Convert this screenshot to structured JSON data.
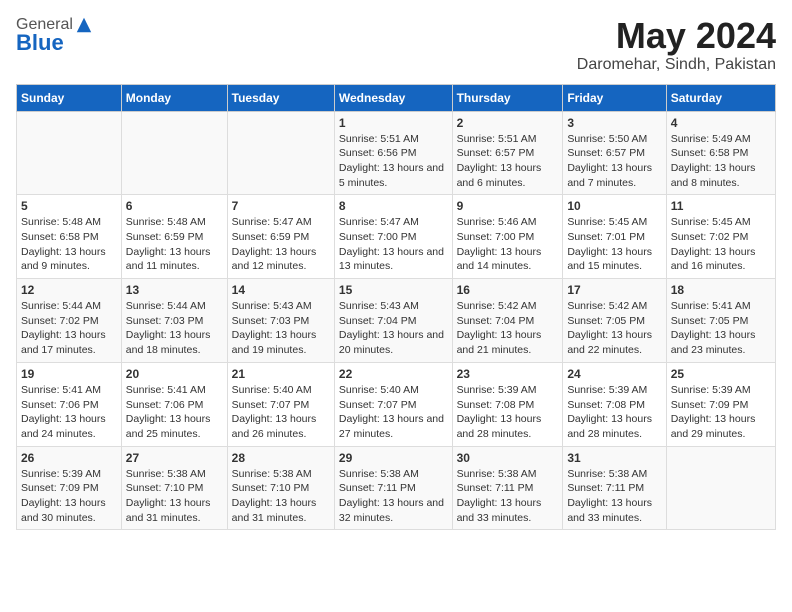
{
  "logo": {
    "general": "General",
    "blue": "Blue"
  },
  "title": "May 2024",
  "subtitle": "Daromehar, Sindh, Pakistan",
  "days_of_week": [
    "Sunday",
    "Monday",
    "Tuesday",
    "Wednesday",
    "Thursday",
    "Friday",
    "Saturday"
  ],
  "weeks": [
    [
      {
        "day": "",
        "content": ""
      },
      {
        "day": "",
        "content": ""
      },
      {
        "day": "",
        "content": ""
      },
      {
        "day": "1",
        "content": "Sunrise: 5:51 AM\nSunset: 6:56 PM\nDaylight: 13 hours and 5 minutes."
      },
      {
        "day": "2",
        "content": "Sunrise: 5:51 AM\nSunset: 6:57 PM\nDaylight: 13 hours and 6 minutes."
      },
      {
        "day": "3",
        "content": "Sunrise: 5:50 AM\nSunset: 6:57 PM\nDaylight: 13 hours and 7 minutes."
      },
      {
        "day": "4",
        "content": "Sunrise: 5:49 AM\nSunset: 6:58 PM\nDaylight: 13 hours and 8 minutes."
      }
    ],
    [
      {
        "day": "5",
        "content": "Sunrise: 5:48 AM\nSunset: 6:58 PM\nDaylight: 13 hours and 9 minutes."
      },
      {
        "day": "6",
        "content": "Sunrise: 5:48 AM\nSunset: 6:59 PM\nDaylight: 13 hours and 11 minutes."
      },
      {
        "day": "7",
        "content": "Sunrise: 5:47 AM\nSunset: 6:59 PM\nDaylight: 13 hours and 12 minutes."
      },
      {
        "day": "8",
        "content": "Sunrise: 5:47 AM\nSunset: 7:00 PM\nDaylight: 13 hours and 13 minutes."
      },
      {
        "day": "9",
        "content": "Sunrise: 5:46 AM\nSunset: 7:00 PM\nDaylight: 13 hours and 14 minutes."
      },
      {
        "day": "10",
        "content": "Sunrise: 5:45 AM\nSunset: 7:01 PM\nDaylight: 13 hours and 15 minutes."
      },
      {
        "day": "11",
        "content": "Sunrise: 5:45 AM\nSunset: 7:02 PM\nDaylight: 13 hours and 16 minutes."
      }
    ],
    [
      {
        "day": "12",
        "content": "Sunrise: 5:44 AM\nSunset: 7:02 PM\nDaylight: 13 hours and 17 minutes."
      },
      {
        "day": "13",
        "content": "Sunrise: 5:44 AM\nSunset: 7:03 PM\nDaylight: 13 hours and 18 minutes."
      },
      {
        "day": "14",
        "content": "Sunrise: 5:43 AM\nSunset: 7:03 PM\nDaylight: 13 hours and 19 minutes."
      },
      {
        "day": "15",
        "content": "Sunrise: 5:43 AM\nSunset: 7:04 PM\nDaylight: 13 hours and 20 minutes."
      },
      {
        "day": "16",
        "content": "Sunrise: 5:42 AM\nSunset: 7:04 PM\nDaylight: 13 hours and 21 minutes."
      },
      {
        "day": "17",
        "content": "Sunrise: 5:42 AM\nSunset: 7:05 PM\nDaylight: 13 hours and 22 minutes."
      },
      {
        "day": "18",
        "content": "Sunrise: 5:41 AM\nSunset: 7:05 PM\nDaylight: 13 hours and 23 minutes."
      }
    ],
    [
      {
        "day": "19",
        "content": "Sunrise: 5:41 AM\nSunset: 7:06 PM\nDaylight: 13 hours and 24 minutes."
      },
      {
        "day": "20",
        "content": "Sunrise: 5:41 AM\nSunset: 7:06 PM\nDaylight: 13 hours and 25 minutes."
      },
      {
        "day": "21",
        "content": "Sunrise: 5:40 AM\nSunset: 7:07 PM\nDaylight: 13 hours and 26 minutes."
      },
      {
        "day": "22",
        "content": "Sunrise: 5:40 AM\nSunset: 7:07 PM\nDaylight: 13 hours and 27 minutes."
      },
      {
        "day": "23",
        "content": "Sunrise: 5:39 AM\nSunset: 7:08 PM\nDaylight: 13 hours and 28 minutes."
      },
      {
        "day": "24",
        "content": "Sunrise: 5:39 AM\nSunset: 7:08 PM\nDaylight: 13 hours and 28 minutes."
      },
      {
        "day": "25",
        "content": "Sunrise: 5:39 AM\nSunset: 7:09 PM\nDaylight: 13 hours and 29 minutes."
      }
    ],
    [
      {
        "day": "26",
        "content": "Sunrise: 5:39 AM\nSunset: 7:09 PM\nDaylight: 13 hours and 30 minutes."
      },
      {
        "day": "27",
        "content": "Sunrise: 5:38 AM\nSunset: 7:10 PM\nDaylight: 13 hours and 31 minutes."
      },
      {
        "day": "28",
        "content": "Sunrise: 5:38 AM\nSunset: 7:10 PM\nDaylight: 13 hours and 31 minutes."
      },
      {
        "day": "29",
        "content": "Sunrise: 5:38 AM\nSunset: 7:11 PM\nDaylight: 13 hours and 32 minutes."
      },
      {
        "day": "30",
        "content": "Sunrise: 5:38 AM\nSunset: 7:11 PM\nDaylight: 13 hours and 33 minutes."
      },
      {
        "day": "31",
        "content": "Sunrise: 5:38 AM\nSunset: 7:11 PM\nDaylight: 13 hours and 33 minutes."
      },
      {
        "day": "",
        "content": ""
      }
    ]
  ]
}
